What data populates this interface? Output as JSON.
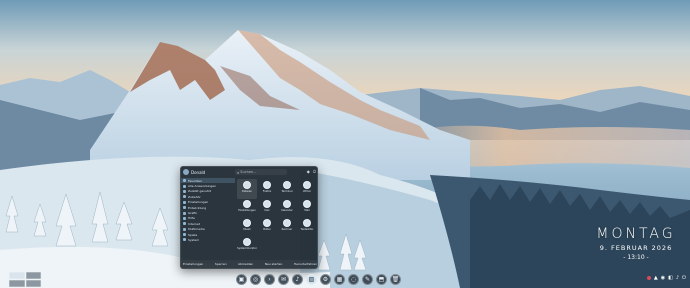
{
  "clock": {
    "day": "MONTAG",
    "date": "9. FEBRUAR 2026",
    "time": "- 13:10 -"
  },
  "launcher": {
    "user": "Donald",
    "search_placeholder": "Suchen...",
    "categories": [
      {
        "label": "Favoriten",
        "selected": true
      },
      {
        "label": "Alle Anwendungen",
        "selected": false
      },
      {
        "label": "Zuletzt genutzt",
        "selected": false
      },
      {
        "label": "Zubehör",
        "selected": false
      },
      {
        "label": "Einstellungen",
        "selected": false
      },
      {
        "label": "Entwicklung",
        "selected": false
      },
      {
        "label": "Grafik",
        "selected": false
      },
      {
        "label": "Hilfe",
        "selected": false
      },
      {
        "label": "Internet",
        "selected": false
      },
      {
        "label": "Multimedia",
        "selected": false
      },
      {
        "label": "Spiele",
        "selected": false
      },
      {
        "label": "System",
        "selected": false
      }
    ],
    "apps": [
      {
        "label": "Dateien",
        "icon": "folder-icon",
        "selected": true
      },
      {
        "label": "Firefox",
        "icon": "globe-icon",
        "selected": false
      },
      {
        "label": "Terminal",
        "icon": "terminal-icon",
        "selected": false
      },
      {
        "label": "Writer",
        "icon": "document-icon",
        "selected": false
      },
      {
        "label": "Einstellungen",
        "icon": "gear-icon",
        "selected": false
      },
      {
        "label": "Calc",
        "icon": "table-icon",
        "selected": false
      },
      {
        "label": "Kalender",
        "icon": "calendar-icon",
        "selected": false
      },
      {
        "label": "Mail",
        "icon": "mail-icon",
        "selected": false
      },
      {
        "label": "Musik",
        "icon": "music-icon",
        "selected": false
      },
      {
        "label": "Bilder",
        "icon": "image-icon",
        "selected": false
      },
      {
        "label": "Rechner",
        "icon": "calculator-icon",
        "selected": false
      },
      {
        "label": "Texteditor",
        "icon": "edit-icon",
        "selected": false
      },
      {
        "label": "Systemmonitor",
        "icon": "monitor-icon",
        "selected": false
      }
    ],
    "bottom": [
      "Einstellungen",
      "Sperren",
      "Abmelden",
      "Neu starten",
      "Herunterfahren"
    ]
  },
  "dock": {
    "icons": [
      "files-icon",
      "browser-icon",
      "terminal-icon",
      "mail-icon",
      "music-icon",
      "image-icon",
      "settings-icon",
      "calendar-icon",
      "chat-icon",
      "editor-icon",
      "store-icon",
      "trash-icon"
    ],
    "glyphs": [
      "▣",
      "◎",
      "›",
      "✉",
      "♪",
      "▨",
      "⚙",
      "▦",
      "◌",
      "✎",
      "⬒",
      "🗑"
    ],
    "active_index": 5
  },
  "tray": {
    "glyphs": [
      "▲",
      "◉",
      "◧",
      "♪",
      "⏻"
    ]
  },
  "colors": {
    "launcher_bg": "#1c262e",
    "accent": "#78a0c3",
    "tray_alert": "#d64a5a"
  }
}
